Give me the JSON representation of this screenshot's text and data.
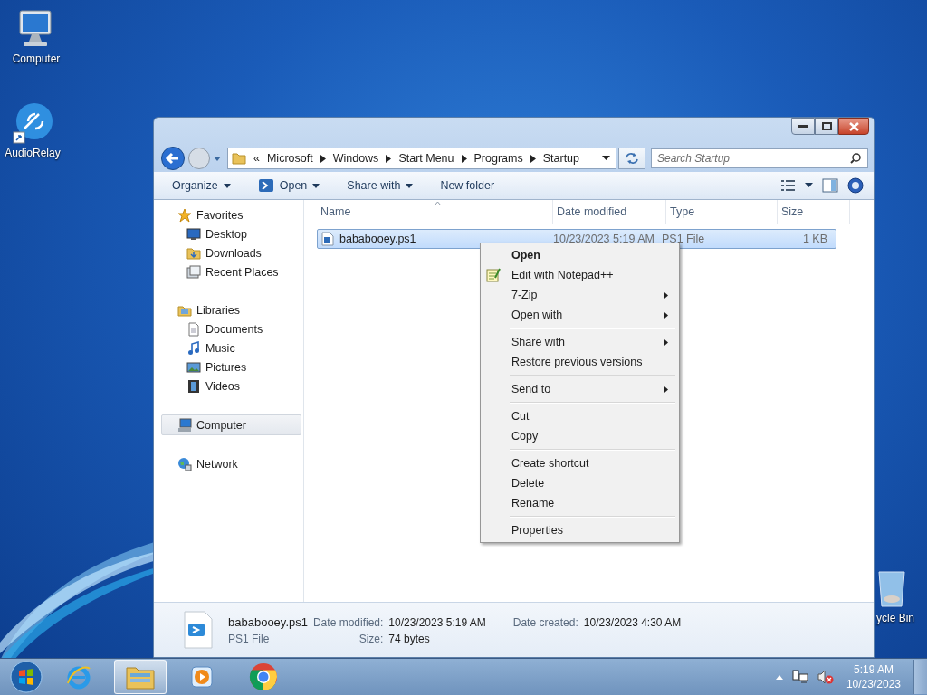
{
  "desktop_icons": [
    {
      "label": "Computer",
      "kind": "computer"
    },
    {
      "label": "AudioRelay",
      "kind": "audiorelay"
    },
    {
      "label": "ycle Bin",
      "kind": "recycle"
    }
  ],
  "window": {
    "breadcrumb": [
      "«",
      "Microsoft",
      "Windows",
      "Start Menu",
      "Programs",
      "Startup"
    ],
    "search": {
      "placeholder": "Search Startup"
    },
    "toolbar": [
      {
        "label": "Organize",
        "kind": "plain",
        "dropdown": true
      },
      {
        "label": "Open",
        "kind": "powershell",
        "dropdown": true
      },
      {
        "label": "Share with",
        "kind": "plain",
        "dropdown": true
      },
      {
        "label": "New folder",
        "kind": "plain",
        "dropdown": false
      }
    ],
    "sidebar": [
      {
        "label": "Favorites",
        "kind": "star",
        "selected": false,
        "children": [
          {
            "label": "Desktop",
            "kind": "desktop",
            "selected": false
          },
          {
            "label": "Downloads",
            "kind": "downloads",
            "selected": false
          },
          {
            "label": "Recent Places",
            "kind": "recent",
            "selected": false
          }
        ]
      },
      {
        "label": "Libraries",
        "kind": "libraries",
        "selected": false,
        "children": [
          {
            "label": "Documents",
            "kind": "documents",
            "selected": false
          },
          {
            "label": "Music",
            "kind": "music",
            "selected": false
          },
          {
            "label": "Pictures",
            "kind": "pictures",
            "selected": false
          },
          {
            "label": "Videos",
            "kind": "videos",
            "selected": false
          }
        ]
      },
      {
        "label": "Computer",
        "kind": "computer",
        "selected": true
      },
      {
        "label": "Network",
        "kind": "network",
        "selected": false
      }
    ],
    "columns": [
      {
        "label": "Name",
        "sorted": true
      },
      {
        "label": "Date modified",
        "sorted": false
      },
      {
        "label": "Type",
        "sorted": false
      },
      {
        "label": "Size",
        "sorted": false
      }
    ],
    "files": [
      {
        "name": "bababooey.ps1",
        "date_modified": "10/23/2023 5:19 AM",
        "type": "PS1 File",
        "size": "1 KB",
        "selected": true
      }
    ],
    "details": {
      "name": "bababooey.ps1",
      "type": "PS1 File",
      "date_modified_label": "Date modified:",
      "date_modified": "10/23/2023 5:19 AM",
      "date_created_label": "Date created:",
      "date_created": "10/23/2023 4:30 AM",
      "size_label": "Size:",
      "size": "74 bytes"
    }
  },
  "context_menu": [
    {
      "kind": "item",
      "label": "Open",
      "default": true,
      "submenu": false,
      "icon": false
    },
    {
      "kind": "item",
      "label": "Edit with Notepad++",
      "default": false,
      "submenu": false,
      "icon": true
    },
    {
      "kind": "item",
      "label": "7-Zip",
      "default": false,
      "submenu": true,
      "icon": false
    },
    {
      "kind": "item",
      "label": "Open with",
      "default": false,
      "submenu": true,
      "icon": false
    },
    {
      "kind": "separator"
    },
    {
      "kind": "item",
      "label": "Share with",
      "default": false,
      "submenu": true,
      "icon": false
    },
    {
      "kind": "item",
      "label": "Restore previous versions",
      "default": false,
      "submenu": false,
      "icon": false
    },
    {
      "kind": "separator"
    },
    {
      "kind": "item",
      "label": "Send to",
      "default": false,
      "submenu": true,
      "icon": false
    },
    {
      "kind": "separator"
    },
    {
      "kind": "item",
      "label": "Cut",
      "default": false,
      "submenu": false,
      "icon": false
    },
    {
      "kind": "item",
      "label": "Copy",
      "default": false,
      "submenu": false,
      "icon": false
    },
    {
      "kind": "separator"
    },
    {
      "kind": "item",
      "label": "Create shortcut",
      "default": false,
      "submenu": false,
      "icon": false
    },
    {
      "kind": "item",
      "label": "Delete",
      "default": false,
      "submenu": false,
      "icon": false
    },
    {
      "kind": "item",
      "label": "Rename",
      "default": false,
      "submenu": false,
      "icon": false
    },
    {
      "kind": "separator"
    },
    {
      "kind": "item",
      "label": "Properties",
      "default": false,
      "submenu": false,
      "icon": false
    }
  ],
  "taskbar": {
    "apps": [
      {
        "kind": "ie",
        "active": false
      },
      {
        "kind": "explorer",
        "active": true
      },
      {
        "kind": "media",
        "active": false
      },
      {
        "kind": "chrome",
        "active": false
      }
    ],
    "time": "5:19 AM",
    "date": "10/23/2023"
  }
}
